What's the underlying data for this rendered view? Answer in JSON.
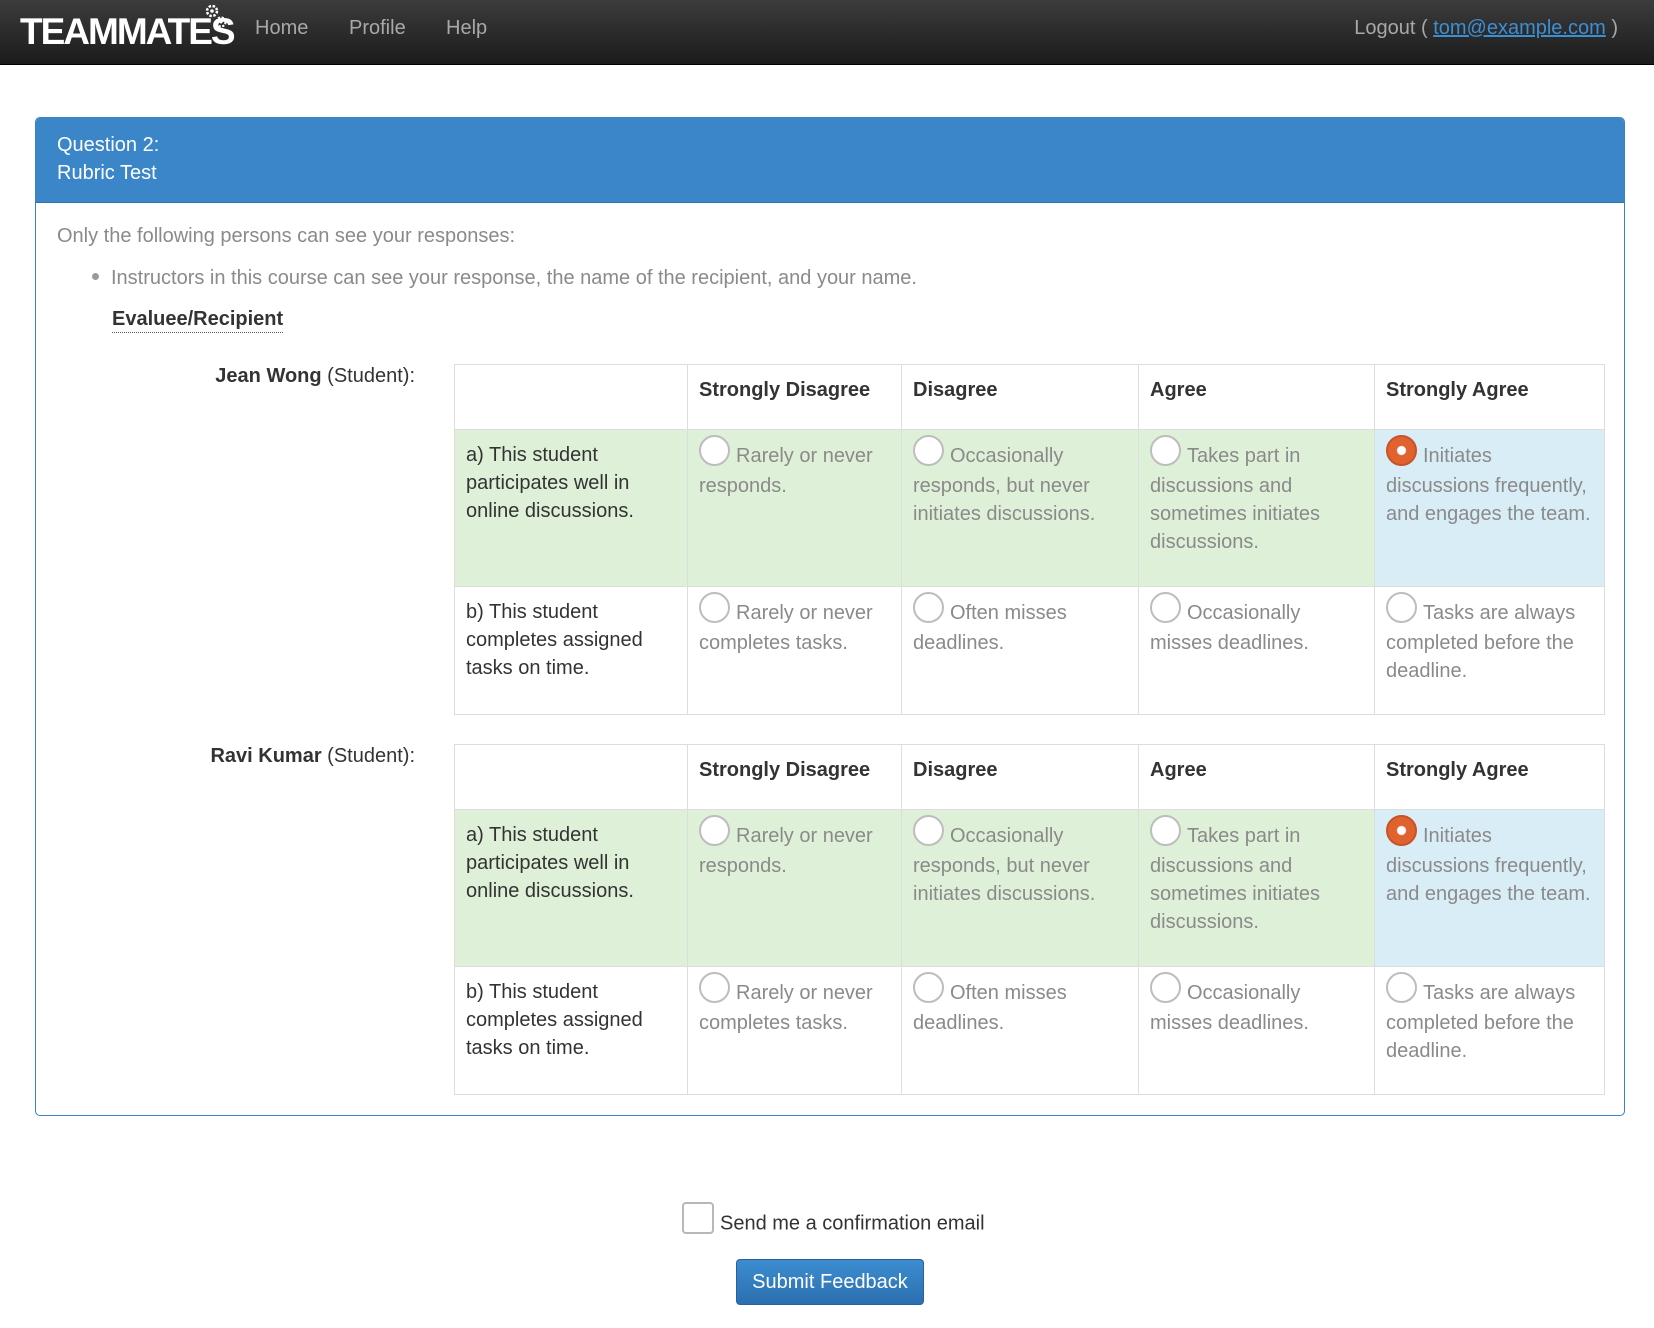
{
  "navbar": {
    "brand": "TEAMMATES",
    "links": [
      "Home",
      "Profile",
      "Help"
    ],
    "logout_prefix": "Logout (",
    "user_email": "tom@example.com",
    "logout_suffix": ")"
  },
  "question": {
    "number_label": "Question 2:",
    "title": "Rubric Test",
    "visibility_label": "Only the following persons can see your responses:",
    "visibility_items": [
      "Instructors in this course can see your response, the name of the recipient, and your name."
    ],
    "evaluee_header": "Evaluee/Recipient"
  },
  "rubric": {
    "choices": [
      "Strongly Disagree",
      "Disagree",
      "Agree",
      "Strongly Agree"
    ],
    "subquestions": [
      {
        "text": "a) This student participates well in online discussions.",
        "descriptions": [
          "Rarely or never responds.",
          "Occasionally responds, but never initiates discussions.",
          "Takes part in discussions and sometimes initiates discussions.",
          "Initiates discussions frequently, and engages the team."
        ]
      },
      {
        "text": "b) This student completes assigned tasks on time.",
        "descriptions": [
          "Rarely or never completes tasks.",
          "Often misses deadlines.",
          "Occasionally misses deadlines.",
          "Tasks are always completed before the deadline."
        ]
      }
    ]
  },
  "recipients": [
    {
      "name": "Jean Wong",
      "role": "(Student):",
      "selected": [
        3,
        null
      ]
    },
    {
      "name": "Ravi Kumar",
      "role": "(Student):",
      "selected": [
        3,
        null
      ]
    }
  ],
  "footer": {
    "confirm_label": "Send me a confirmation email",
    "confirm_checked": false,
    "submit_label": "Submit Feedback"
  },
  "colors": {
    "navbar": "#222222",
    "panel_heading": "#3a86c8",
    "row_highlight": "#dff0d8",
    "selected_cell": "#d9edf7",
    "radio_checked": "#e0622f",
    "link": "#3b8fd3"
  }
}
